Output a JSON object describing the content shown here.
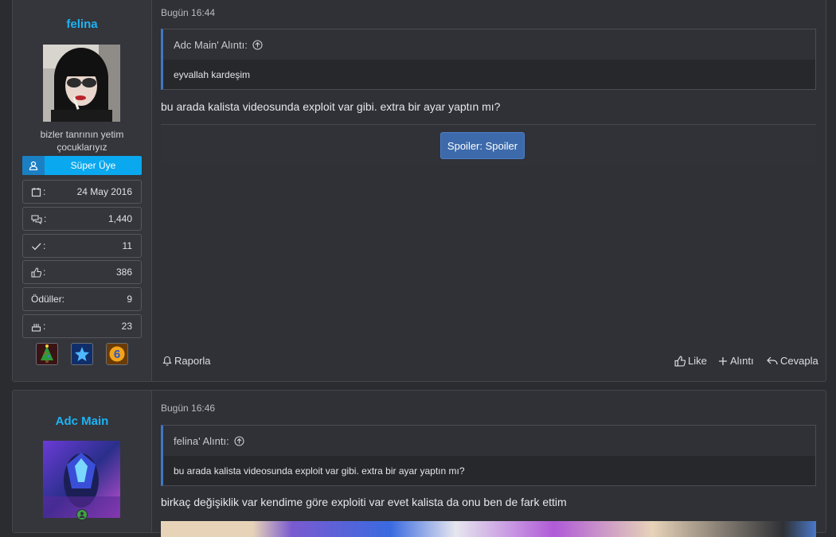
{
  "posts": [
    {
      "username": "felina",
      "user_title": "bizler tanrının yetim çocuklarıyız",
      "rank": "Süper Üye",
      "stats": [
        {
          "icon": "calendar-icon",
          "key": ":",
          "value": "24 May 2016"
        },
        {
          "icon": "messages-icon",
          "key": ":",
          "value": "1,440"
        },
        {
          "icon": "check-icon",
          "key": ":",
          "value": "11"
        },
        {
          "icon": "thumbs-up-icon",
          "key": ":",
          "value": "386"
        },
        {
          "icon": "",
          "key": "Ödüller:",
          "value": "9"
        },
        {
          "icon": "cake-icon",
          "key": ":",
          "value": "23"
        }
      ],
      "time": "Bugün 16:44",
      "quote_author": "Adc Main' Alıntı:",
      "quote_text": "eyvallah kardeşim",
      "message": "bu arada kalista videosunda exploit var gibi. extra bir ayar yaptın mı?",
      "spoiler_label": "Spoiler: Spoiler",
      "report_label": "Raporla",
      "like_label": "Like",
      "quote_label": "Alıntı",
      "reply_label": "Cevapla"
    },
    {
      "username": "Adc Main",
      "time": "Bugün 16:46",
      "quote_author": "felina' Alıntı:",
      "quote_text": "bu arada kalista videosunda exploit var gibi. extra bir ayar yaptın mı?",
      "message": "birkaç değişiklik var kendime göre exploiti var evet kalista da onu ben de fark ettim"
    }
  ],
  "colors": {
    "username": "#1eb3f5",
    "rank_bg": "#0aa8ee",
    "quote_border": "#3e77c6",
    "spoiler_bg": "#3d6aab"
  }
}
